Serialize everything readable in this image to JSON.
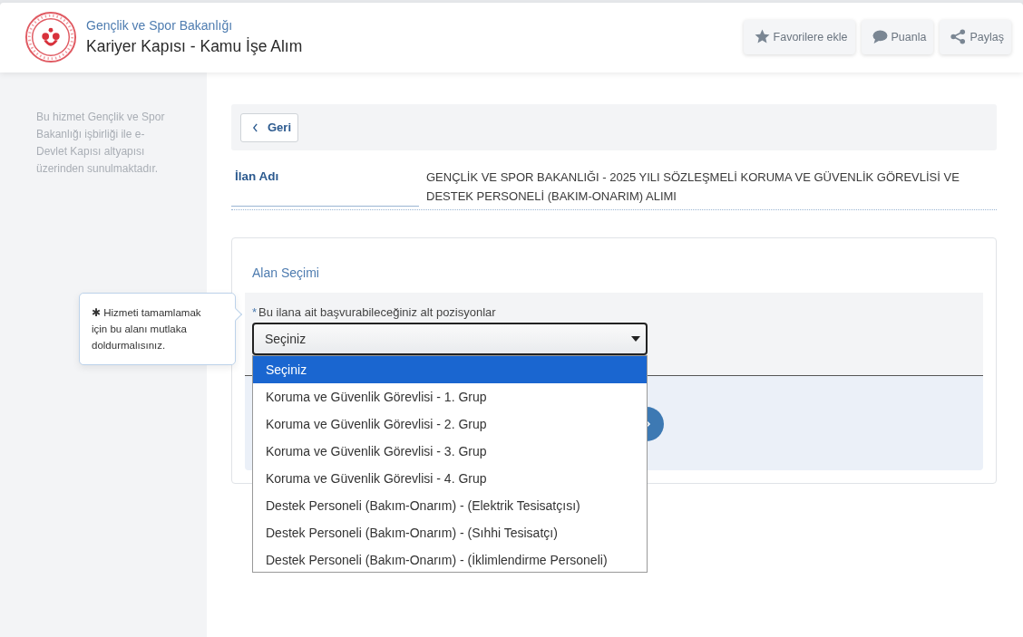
{
  "header": {
    "ministry": "Gençlik ve Spor Bakanlığı",
    "title": "Kariyer Kapısı - Kamu İşe Alım"
  },
  "actions": [
    {
      "kind": "star",
      "label": "Favorilere ekle"
    },
    {
      "kind": "comment",
      "label": "Puanla"
    },
    {
      "kind": "share",
      "label": "Paylaş"
    }
  ],
  "sidebar": {
    "note": "Bu hizmet Gençlik ve Spor Bakanlığı işbirliği ile e-Devlet Kapısı altyapısı üzerinden sunulmaktadır."
  },
  "back_button": {
    "label": "Geri"
  },
  "listing": {
    "label": "İlan Adı",
    "value": "GENÇLİK VE SPOR BAKANLIĞI - 2025 YILI SÖZLEŞMELİ KORUMA VE GÜVENLİK GÖREVLİSİ VE DESTEK PERSONELİ (BAKIM-ONARIM) ALIMI"
  },
  "section": {
    "title": "Alan Seçimi",
    "tooltip": {
      "text": "✱ Hizmeti tamamlamak için bu alanı mutlaka doldurmalısınız."
    },
    "field": {
      "required_mark": "*",
      "label": "Bu ilana ait başvurabileceğiniz alt pozisyonlar",
      "value": "Seçiniz",
      "expanded": true,
      "options": [
        {
          "label": "Seçiniz",
          "selected": true
        },
        {
          "label": "Koruma ve Güvenlik Görevlisi - 1. Grup",
          "selected": false
        },
        {
          "label": "Koruma ve Güvenlik Görevlisi - 2. Grup",
          "selected": false
        },
        {
          "label": "Koruma ve Güvenlik Görevlisi - 3. Grup",
          "selected": false
        },
        {
          "label": "Koruma ve Güvenlik Görevlisi - 4. Grup",
          "selected": false
        },
        {
          "label": "Destek Personeli (Bakım-Onarım) - (Elektrik Tesisatçısı)",
          "selected": false
        },
        {
          "label": "Destek Personeli (Bakım-Onarım) - (Sıhhi Tesisatçı)",
          "selected": false
        },
        {
          "label": "Destek Personeli (Bakım-Onarım) - (İklimlendirme Personeli)",
          "selected": false
        }
      ]
    }
  }
}
